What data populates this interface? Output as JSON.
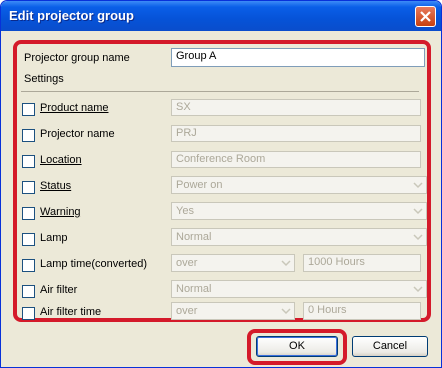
{
  "window": {
    "title": "Edit projector group"
  },
  "group_name": {
    "label": "Projector group name",
    "value": "Group A"
  },
  "settings_label": "Settings",
  "rows": [
    {
      "label": "Product name",
      "value": "SX",
      "type": "text"
    },
    {
      "label": "Projector name",
      "value": "PRJ",
      "type": "text"
    },
    {
      "label": "Location",
      "value": "Conference Room",
      "type": "text"
    },
    {
      "label": "Status",
      "value": "Power on",
      "type": "select"
    },
    {
      "label": "Warning",
      "value": "Yes",
      "type": "select"
    },
    {
      "label": "Lamp",
      "value": "Normal",
      "type": "select"
    },
    {
      "label": "Lamp time(converted)",
      "value": "over",
      "extra": "1000 Hours",
      "type": "select+text"
    },
    {
      "label": "Air filter",
      "value": "Normal",
      "type": "select"
    },
    {
      "label": "Air filter time",
      "value": "over",
      "extra": "0 Hours",
      "type": "select+text"
    }
  ],
  "buttons": {
    "ok": "OK",
    "cancel": "Cancel"
  },
  "colors": {
    "highlight": "#d41a2a",
    "titlebar": "#0653d8"
  }
}
